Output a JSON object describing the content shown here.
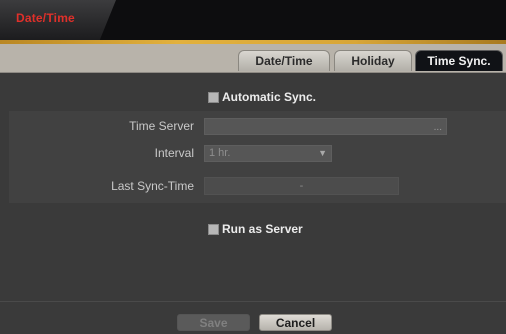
{
  "window": {
    "title": "Date/Time"
  },
  "tabs": [
    {
      "label": "Date/Time",
      "active": false
    },
    {
      "label": "Holiday",
      "active": false
    },
    {
      "label": "Time Sync.",
      "active": true
    }
  ],
  "automatic_sync": {
    "label": "Automatic Sync.",
    "checked": false
  },
  "time_server": {
    "label": "Time Server",
    "value": "",
    "browse": "..."
  },
  "interval": {
    "label": "Interval",
    "value": "1 hr."
  },
  "last_sync": {
    "label": "Last Sync-Time",
    "value": "-"
  },
  "run_as_server": {
    "label": "Run as Server",
    "checked": false
  },
  "buttons": {
    "save": "Save",
    "cancel": "Cancel"
  },
  "colors": {
    "title_text": "#e0302a",
    "accent_line": "#e2b13d",
    "active_tab": "#101216"
  }
}
